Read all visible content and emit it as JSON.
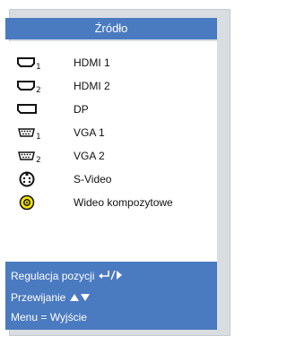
{
  "menu": {
    "title": "Źródło",
    "items": [
      {
        "label": "HDMI 1",
        "icon": "hdmi-1-icon"
      },
      {
        "label": "HDMI 2",
        "icon": "hdmi-2-icon"
      },
      {
        "label": "DP",
        "icon": "displayport-icon"
      },
      {
        "label": "VGA 1",
        "icon": "vga-1-icon"
      },
      {
        "label": "VGA 2",
        "icon": "vga-2-icon"
      },
      {
        "label": "S-Video",
        "icon": "s-video-icon"
      },
      {
        "label": "Wideo kompozytowe",
        "icon": "composite-video-icon"
      }
    ]
  },
  "footer": {
    "adjust_label": "Regulacja pozycji",
    "scroll_label": "Przewijanie",
    "exit_label": "Menu = Wyjście"
  },
  "colors": {
    "header_bg": "#4a7ac0",
    "frame_bg": "#d9dde2",
    "composite_yellow": "#f5e000"
  }
}
